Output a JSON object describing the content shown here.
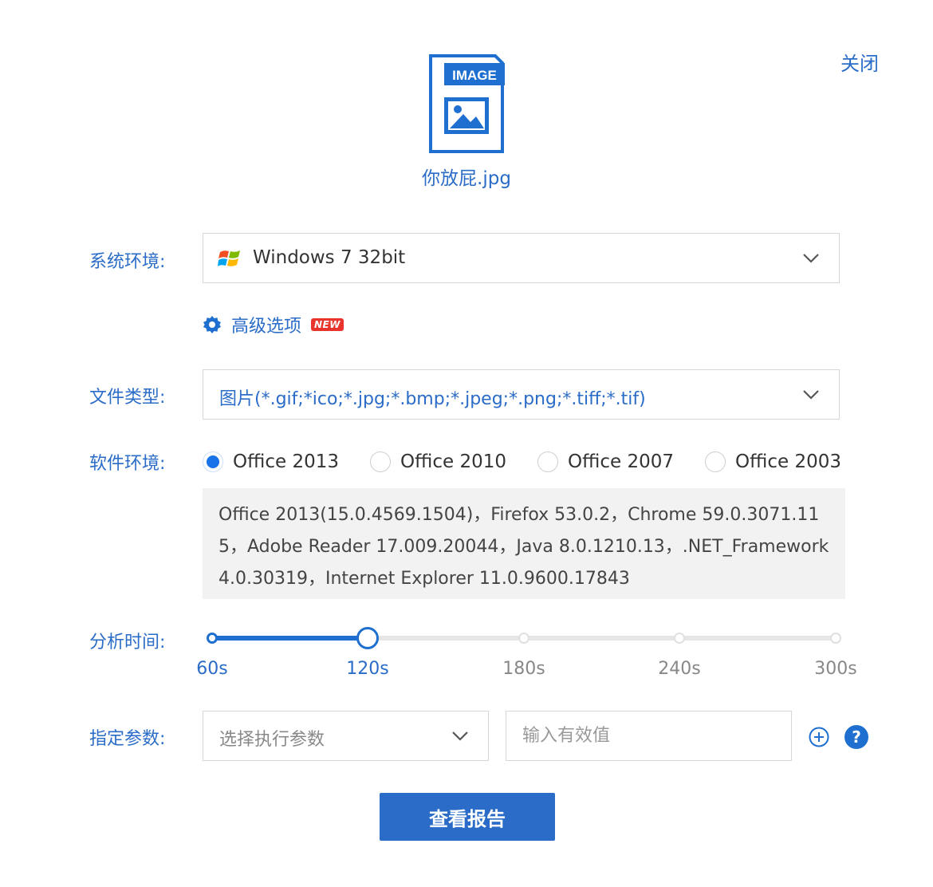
{
  "header": {
    "close_label": "关闭"
  },
  "file": {
    "badge_text": "IMAGE",
    "name": "你放屁.jpg"
  },
  "system_env": {
    "label": "系统环境:",
    "selected": "Windows 7 32bit",
    "icon": "windows-logo-icon"
  },
  "advanced": {
    "label": "高级选项",
    "badge": "NEW",
    "icon": "gear-icon"
  },
  "file_type": {
    "label": "文件类型:",
    "selected": "图片(*.gif;*ico;*.jpg;*.bmp;*.jpeg;*.png;*.tiff;*.tif)"
  },
  "software_env": {
    "label": "软件环境:",
    "options": [
      {
        "label": "Office 2013",
        "checked": true
      },
      {
        "label": "Office 2010",
        "checked": false
      },
      {
        "label": "Office 2007",
        "checked": false
      },
      {
        "label": "Office 2003",
        "checked": false
      }
    ],
    "info": "Office 2013(15.0.4569.1504)，Firefox 53.0.2，Chrome 59.0.3071.115，Adobe Reader 17.009.20044，Java 8.0.1210.13，.NET_Framework 4.0.30319，Internet Explorer 11.0.9600.17843"
  },
  "analysis_time": {
    "label": "分析时间:",
    "stops": [
      "60s",
      "120s",
      "180s",
      "240s",
      "300s"
    ],
    "selected": "120s"
  },
  "params": {
    "label": "指定参数:",
    "select_placeholder": "选择执行参数",
    "input_placeholder": "输入有效值"
  },
  "submit_label": "查看报告",
  "colors": {
    "accent": "#2a6cc7",
    "slider": "#1f6fd1",
    "badge": "#e8342c"
  }
}
